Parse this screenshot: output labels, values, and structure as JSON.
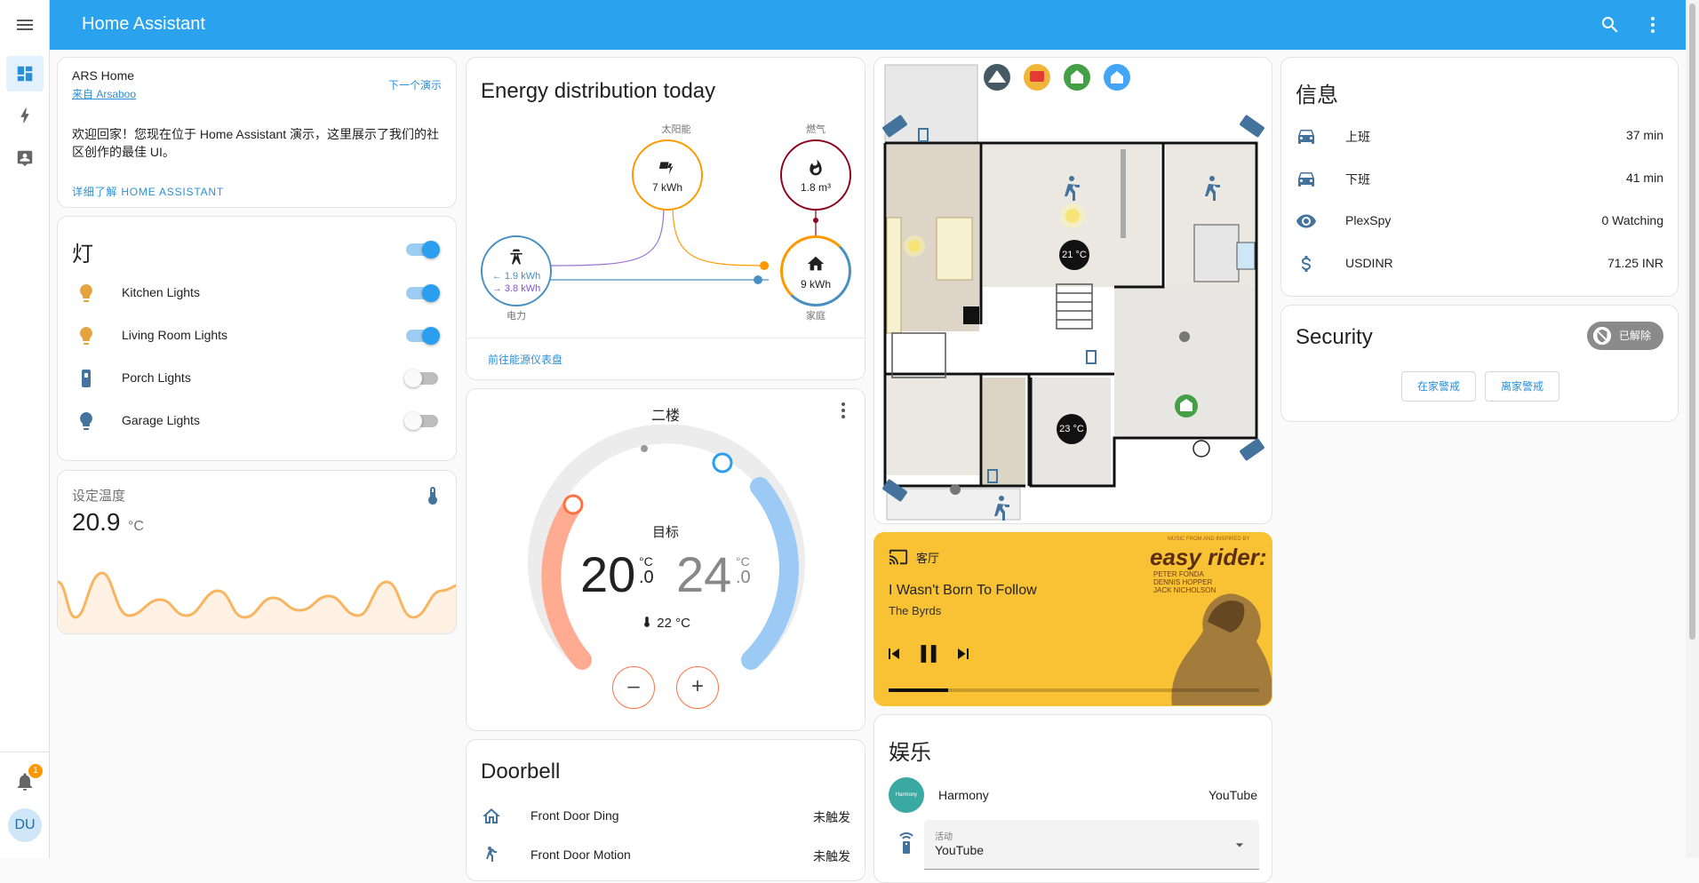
{
  "app": {
    "title": "Home Assistant"
  },
  "sidebar": {
    "badge": "1",
    "avatar": "DU"
  },
  "welcome": {
    "name": "ARS Home",
    "from": "来自 Arsaboo",
    "next": "下一个演示",
    "body": "欢迎回家！您现在位于 Home Assistant 演示，这里展示了我们的社区创作的最佳 UI。",
    "learn": "详细了解 HOME ASSISTANT"
  },
  "lights": {
    "title": "灯",
    "items": [
      {
        "label": "Kitchen Lights",
        "on": true
      },
      {
        "label": "Living Room Lights",
        "on": true
      },
      {
        "label": "Porch Lights",
        "on": false
      },
      {
        "label": "Garage Lights",
        "on": false
      }
    ]
  },
  "temp_sensor": {
    "title": "设定温度",
    "value": "20.9",
    "unit": "°C"
  },
  "energy": {
    "title": "Energy distribution today",
    "solar_label": "太阳能",
    "solar_value": "7 kWh",
    "gas_label": "燃气",
    "gas_value": "1.8 m³",
    "grid_label": "电力",
    "grid_in": "1.9 kWh",
    "grid_out": "3.8 kWh",
    "home_label": "家庭",
    "home_value": "9 kWh",
    "link": "前往能源仪表盘"
  },
  "thermostat": {
    "title": "二楼",
    "target_label": "目标",
    "low": "20",
    "low_dec": ".0",
    "high": "24",
    "high_dec": ".0",
    "unit": "°C",
    "current": "22 °C",
    "minus": "–",
    "plus": "+"
  },
  "doorbell": {
    "title": "Doorbell",
    "rows": [
      {
        "name": "Front Door Ding",
        "state": "未触发"
      },
      {
        "name": "Front Door Motion",
        "state": "未触发"
      }
    ]
  },
  "floorplan": {
    "temp1": "21 °C",
    "temp2": "23 °C"
  },
  "media": {
    "room": "客厅",
    "song": "I Wasn't Born To Follow",
    "artist": "The Byrds",
    "album_line": "MUSIC FROM AND INSPIRED BY",
    "album_title": "easy rider:",
    "credits": [
      "PETER FONDA",
      "DENNIS HOPPER",
      "JACK NICHOLSON"
    ],
    "progress": 0.16
  },
  "entertainment": {
    "title": "娱乐",
    "harmony": "Harmony",
    "harmony_state": "YouTube",
    "harmony_logo": "Harmony",
    "activity_label": "活动",
    "activity_value": "YouTube"
  },
  "info": {
    "title": "信息",
    "rows": [
      {
        "icon": "car-icon",
        "name": "上班",
        "value": "37 min"
      },
      {
        "icon": "car-icon",
        "name": "下班",
        "value": "41 min"
      },
      {
        "icon": "eye-icon",
        "name": "PlexSpy",
        "value": "0 Watching"
      },
      {
        "icon": "dollar-icon",
        "name": "USDINR",
        "value": "71.25 INR"
      }
    ]
  },
  "security": {
    "title": "Security",
    "state": "已解除",
    "home_btn": "在家警戒",
    "away_btn": "离家警戒"
  },
  "colors": {
    "header": "#2aa2ee",
    "accent": "#2a9ff0",
    "media_bg": "#f8c234",
    "heat": "#ff9a76",
    "cool": "#9bcbf5"
  }
}
